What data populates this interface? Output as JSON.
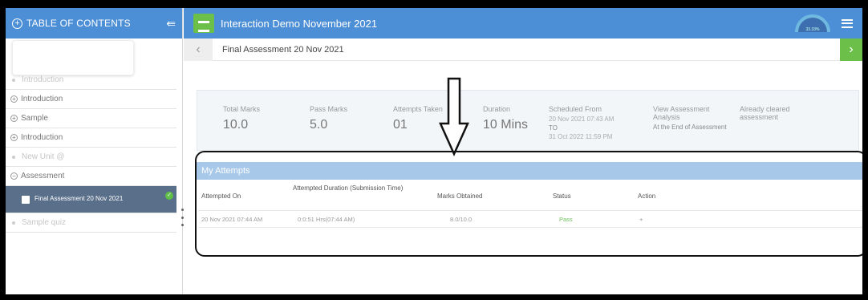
{
  "sidebar": {
    "title": "TABLE OF CONTENTS",
    "items": [
      {
        "label": "Introduction",
        "type": "dot"
      },
      {
        "label": "Introduction",
        "type": "plus"
      },
      {
        "label": "Sample",
        "type": "plus"
      },
      {
        "label": "Introduction",
        "type": "plus"
      },
      {
        "label": "New Unit @",
        "type": "dot"
      },
      {
        "label": "Assessment",
        "type": "minus"
      }
    ],
    "active_item": "Final Assessment 20 Nov 2021",
    "after_item": "Sample quiz"
  },
  "topbar": {
    "title": "Interaction Demo November 2021",
    "gauge_label": "33.33%"
  },
  "breadcrumb": {
    "title": "Final Assessment 20 Nov 2021"
  },
  "summary": {
    "total_marks_label": "Total Marks",
    "total_marks": "10.0",
    "pass_marks_label": "Pass Marks",
    "pass_marks": "5.0",
    "attempts_label": "Attempts Taken",
    "attempts": "01",
    "duration_label": "Duration",
    "duration": "10 Mins",
    "scheduled_label": "Scheduled From",
    "scheduled_from": "20 Nov 2021 07:43 AM",
    "scheduled_to_label": "TO",
    "scheduled_to": "31 Oct 2022 11:59 PM",
    "view_label": "View Assessment Analysis",
    "view_value": "At the End of Assessment",
    "cleared_text": "Already cleared assessment"
  },
  "attempts": {
    "heading": "My Attempts",
    "columns": [
      "Attempted On",
      "Attempted Duration (Submission Time)",
      "Marks Obtained",
      "Status",
      "Action"
    ],
    "rows": [
      {
        "attempted_on": "20 Nov 2021 07:44 AM",
        "duration": "0:0:51 Hrs(07:44 AM)",
        "marks": "8.0/10.0",
        "status": "Pass",
        "action": "+"
      }
    ]
  },
  "colors": {
    "header_blue": "#4d8fd6",
    "green": "#6cc04a",
    "attempts_header": "#a8c8ea"
  }
}
